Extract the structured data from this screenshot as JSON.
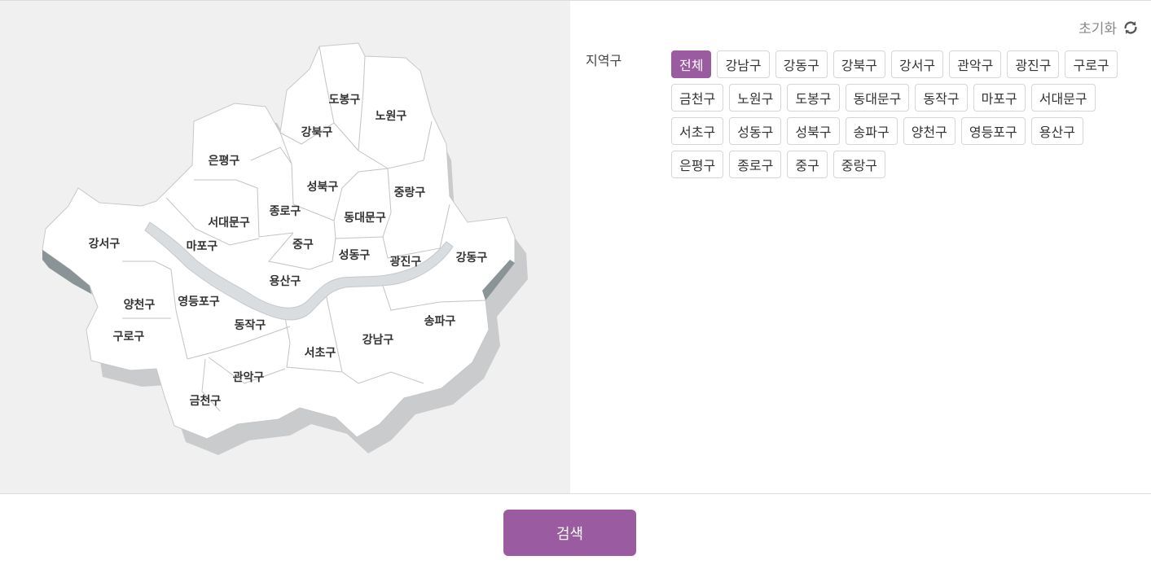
{
  "map": {
    "districts": [
      {
        "id": "dobong",
        "label": "도봉구"
      },
      {
        "id": "nowon",
        "label": "노원구"
      },
      {
        "id": "gangbuk",
        "label": "강북구"
      },
      {
        "id": "eunpyeong",
        "label": "은평구"
      },
      {
        "id": "seongbuk",
        "label": "성북구"
      },
      {
        "id": "jungnang",
        "label": "중랑구"
      },
      {
        "id": "jongno",
        "label": "종로구"
      },
      {
        "id": "seodaemun",
        "label": "서대문구"
      },
      {
        "id": "dongdaemun",
        "label": "동대문구"
      },
      {
        "id": "gangseo",
        "label": "강서구"
      },
      {
        "id": "mapo",
        "label": "마포구"
      },
      {
        "id": "jung",
        "label": "중구"
      },
      {
        "id": "seongdong",
        "label": "성동구"
      },
      {
        "id": "gwangjin",
        "label": "광진구"
      },
      {
        "id": "gangdong",
        "label": "강동구"
      },
      {
        "id": "yongsan",
        "label": "용산구"
      },
      {
        "id": "yangcheon",
        "label": "양천구"
      },
      {
        "id": "yeongdeungpo",
        "label": "영등포구"
      },
      {
        "id": "songpa",
        "label": "송파구"
      },
      {
        "id": "dongjak",
        "label": "동작구"
      },
      {
        "id": "guro",
        "label": "구로구"
      },
      {
        "id": "gangnam",
        "label": "강남구"
      },
      {
        "id": "seocho",
        "label": "서초구"
      },
      {
        "id": "gwanak",
        "label": "관악구"
      },
      {
        "id": "geumcheon",
        "label": "금천구"
      }
    ]
  },
  "filter": {
    "reset_label": "초기화",
    "reset_icon": "refresh-icon",
    "label": "지역구",
    "active_index": 0,
    "accent_color": "#9b5ba0",
    "chips": [
      "전체",
      "강남구",
      "강동구",
      "강북구",
      "강서구",
      "관악구",
      "광진구",
      "구로구",
      "금천구",
      "노원구",
      "도봉구",
      "동대문구",
      "동작구",
      "마포구",
      "서대문구",
      "서초구",
      "성동구",
      "성북구",
      "송파구",
      "양천구",
      "영등포구",
      "용산구",
      "은평구",
      "종로구",
      "중구",
      "중랑구"
    ]
  },
  "search": {
    "label": "검색"
  }
}
